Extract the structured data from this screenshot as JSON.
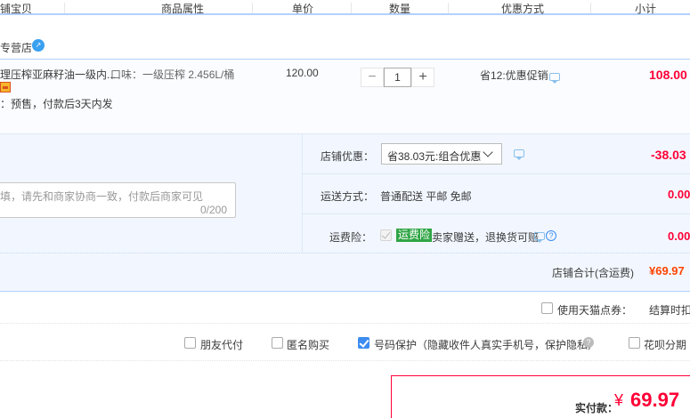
{
  "header": {
    "columns": [
      "铺宝贝",
      "商品属性",
      "单价",
      "数量",
      "优惠方式",
      "小计"
    ]
  },
  "shop": {
    "name": "专营店",
    "icon": "shop-badge-icon"
  },
  "item": {
    "title": "理压榨亚麻籽油一级内...",
    "attribute": "口味：一级压榨 2.456L/桶",
    "unit_price": "120.00",
    "quantity": "1",
    "minus_label": "−",
    "plus_label": "+",
    "promotion": "省12:优惠促销",
    "subtotal": "108.00",
    "presale_note": "：预售，付款后3天内发"
  },
  "options": {
    "message_placeholder": "填，请先和商家协商一致，付款后商家可见",
    "message_counter": "0/200",
    "store_discount_label": "店铺优惠：",
    "store_discount_value": "省38.03元:组合优惠",
    "store_discount_amount": "-38.03",
    "shipping_label": "运送方式：",
    "shipping_value": "普通配送 平邮 免邮",
    "shipping_amount": "0.00",
    "insurance_label": "运费险：",
    "insurance_badge": "运费险",
    "insurance_text": "卖家赠送，退换货可赔",
    "insurance_amount": "0.00"
  },
  "store_total": {
    "label": "店铺合计(含运费)",
    "value": "¥69.97"
  },
  "tmall_points": {
    "label": "使用天猫点券：",
    "settle_text": "结算时扣"
  },
  "checkout_options": {
    "friend_pay": "朋友代付",
    "anonymous": "匿名购买",
    "number_protect": "号码保护（隐藏收件人真实手机号，保护隐私）",
    "huabei": "花呗分期"
  },
  "payment": {
    "label": "实付款：",
    "currency": "¥",
    "amount": "69.97"
  }
}
